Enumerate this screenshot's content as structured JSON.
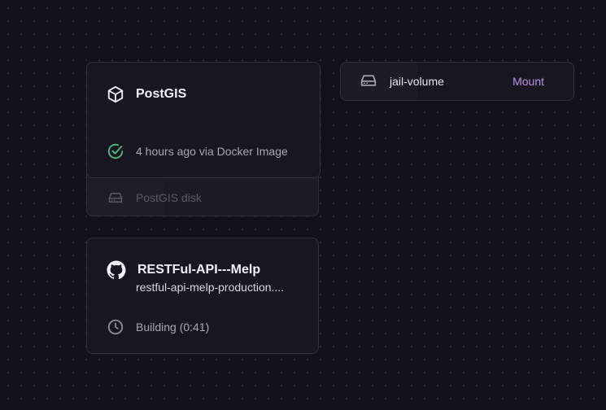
{
  "canvas": {
    "services": [
      {
        "name": "PostGIS",
        "icon": "cube-icon",
        "status": "4 hours ago via Docker Image",
        "status_icon": "check-circle-icon",
        "status_color": "#4fb889",
        "attached_volume": "PostGIS disk"
      },
      {
        "name": "RESTFul-API---Melp",
        "icon": "github-icon",
        "subtitle": "restful-api-melp-production....",
        "status": "Building (0:41)",
        "status_icon": "clock-icon"
      }
    ],
    "volume": {
      "name": "jail-volume",
      "action": "Mount",
      "icon": "hard-drive-icon",
      "action_color": "#b892e6"
    }
  }
}
